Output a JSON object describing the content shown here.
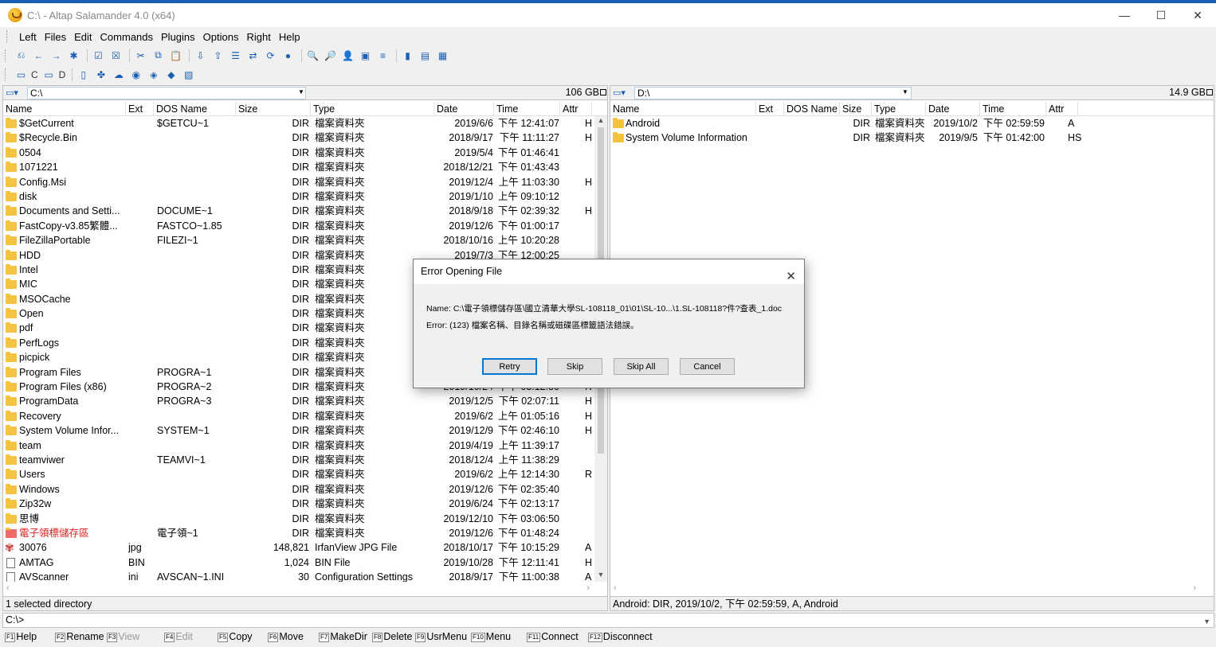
{
  "window": {
    "title": "C:\\ - Altap Salamander 4.0 (x64)",
    "minimize": "—",
    "maximize": "☐",
    "close": "✕"
  },
  "menu": [
    "Left",
    "Files",
    "Edit",
    "Commands",
    "Plugins",
    "Options",
    "Right",
    "Help"
  ],
  "drive_bar": {
    "c": "C",
    "d": "D"
  },
  "left_panel": {
    "path": "C:\\",
    "free_space": "106 GB",
    "columns": [
      "Name",
      "Ext",
      "DOS Name",
      "Size",
      "Type",
      "Date",
      "Time",
      "Attr"
    ],
    "rows": [
      {
        "icon": "folder",
        "name": "$GetCurrent",
        "ext": "",
        "dos": "$GETCU~1",
        "size": "DIR",
        "type": "檔案資料夾",
        "date": "2019/6/6",
        "time": "下午 12:41:07",
        "attr": "H"
      },
      {
        "icon": "folder",
        "name": "$Recycle.Bin",
        "ext": "",
        "dos": "",
        "size": "DIR",
        "type": "檔案資料夾",
        "date": "2018/9/17",
        "time": "下午 11:11:27",
        "attr": "HS"
      },
      {
        "icon": "folder",
        "name": "0504",
        "ext": "",
        "dos": "",
        "size": "DIR",
        "type": "檔案資料夾",
        "date": "2019/5/4",
        "time": "下午 01:46:41",
        "attr": ""
      },
      {
        "icon": "folder",
        "name": "1071221",
        "ext": "",
        "dos": "",
        "size": "DIR",
        "type": "檔案資料夾",
        "date": "2018/12/21",
        "time": "下午 01:43:43",
        "attr": ""
      },
      {
        "icon": "folder",
        "name": "Config.Msi",
        "ext": "",
        "dos": "",
        "size": "DIR",
        "type": "檔案資料夾",
        "date": "2019/12/4",
        "time": "上午 11:03:30",
        "attr": "HS"
      },
      {
        "icon": "folder",
        "name": "disk",
        "ext": "",
        "dos": "",
        "size": "DIR",
        "type": "檔案資料夾",
        "date": "2019/1/10",
        "time": "上午 09:10:12",
        "attr": ""
      },
      {
        "icon": "link",
        "name": "Documents and Setti...",
        "ext": "",
        "dos": "DOCUME~1",
        "size": "DIR",
        "type": "檔案資料夾",
        "date": "2018/9/18",
        "time": "下午 02:39:32",
        "attr": "HS"
      },
      {
        "icon": "folder",
        "name": "FastCopy-v3.85繁體...",
        "ext": "",
        "dos": "FASTCO~1.85",
        "size": "DIR",
        "type": "檔案資料夾",
        "date": "2019/12/6",
        "time": "下午 01:00:17",
        "attr": ""
      },
      {
        "icon": "folder",
        "name": "FileZillaPortable",
        "ext": "",
        "dos": "FILEZI~1",
        "size": "DIR",
        "type": "檔案資料夾",
        "date": "2018/10/16",
        "time": "上午 10:20:28",
        "attr": ""
      },
      {
        "icon": "folder",
        "name": "HDD",
        "ext": "",
        "dos": "",
        "size": "DIR",
        "type": "檔案資料夾",
        "date": "2019/7/3",
        "time": "下午 12:00:25",
        "attr": ""
      },
      {
        "icon": "folder",
        "name": "Intel",
        "ext": "",
        "dos": "",
        "size": "DIR",
        "type": "檔案資料夾",
        "date": "",
        "time": "",
        "attr": ""
      },
      {
        "icon": "folder",
        "name": "MIC",
        "ext": "",
        "dos": "",
        "size": "DIR",
        "type": "檔案資料夾",
        "date": "",
        "time": "",
        "attr": ""
      },
      {
        "icon": "folder",
        "name": "MSOCache",
        "ext": "",
        "dos": "",
        "size": "DIR",
        "type": "檔案資料夾",
        "date": "",
        "time": "",
        "attr": ""
      },
      {
        "icon": "folder",
        "name": "Open",
        "ext": "",
        "dos": "",
        "size": "DIR",
        "type": "檔案資料夾",
        "date": "",
        "time": "",
        "attr": ""
      },
      {
        "icon": "folder",
        "name": "pdf",
        "ext": "",
        "dos": "",
        "size": "DIR",
        "type": "檔案資料夾",
        "date": "",
        "time": "",
        "attr": ""
      },
      {
        "icon": "folder",
        "name": "PerfLogs",
        "ext": "",
        "dos": "",
        "size": "DIR",
        "type": "檔案資料夾",
        "date": "",
        "time": "",
        "attr": ""
      },
      {
        "icon": "folder",
        "name": "picpick",
        "ext": "",
        "dos": "",
        "size": "DIR",
        "type": "檔案資料夾",
        "date": "",
        "time": "",
        "attr": ""
      },
      {
        "icon": "folder",
        "name": "Program Files",
        "ext": "",
        "dos": "PROGRA~1",
        "size": "DIR",
        "type": "檔案資料夾",
        "date": "",
        "time": "",
        "attr": ""
      },
      {
        "icon": "folder",
        "name": "Program Files (x86)",
        "ext": "",
        "dos": "PROGRA~2",
        "size": "DIR",
        "type": "檔案資料夾",
        "date": "2019/10/24",
        "time": "下午 03:12:50",
        "attr": "R"
      },
      {
        "icon": "folder",
        "name": "ProgramData",
        "ext": "",
        "dos": "PROGRA~3",
        "size": "DIR",
        "type": "檔案資料夾",
        "date": "2019/12/5",
        "time": "下午 02:07:11",
        "attr": "H"
      },
      {
        "icon": "folder",
        "name": "Recovery",
        "ext": "",
        "dos": "",
        "size": "DIR",
        "type": "檔案資料夾",
        "date": "2019/6/2",
        "time": "上午 01:05:16",
        "attr": "HS"
      },
      {
        "icon": "folder",
        "name": "System Volume Infor...",
        "ext": "",
        "dos": "SYSTEM~1",
        "size": "DIR",
        "type": "檔案資料夾",
        "date": "2019/12/9",
        "time": "下午 02:46:10",
        "attr": "HS"
      },
      {
        "icon": "folder",
        "name": "team",
        "ext": "",
        "dos": "",
        "size": "DIR",
        "type": "檔案資料夾",
        "date": "2019/4/19",
        "time": "上午 11:39:17",
        "attr": ""
      },
      {
        "icon": "folder",
        "name": "teamviwer",
        "ext": "",
        "dos": "TEAMVI~1",
        "size": "DIR",
        "type": "檔案資料夾",
        "date": "2018/12/4",
        "time": "上午 11:38:29",
        "attr": ""
      },
      {
        "icon": "folder",
        "name": "Users",
        "ext": "",
        "dos": "",
        "size": "DIR",
        "type": "檔案資料夾",
        "date": "2019/6/2",
        "time": "上午 12:14:30",
        "attr": "R"
      },
      {
        "icon": "folder",
        "name": "Windows",
        "ext": "",
        "dos": "",
        "size": "DIR",
        "type": "檔案資料夾",
        "date": "2019/12/6",
        "time": "下午 02:35:40",
        "attr": ""
      },
      {
        "icon": "folder",
        "name": "Zip32w",
        "ext": "",
        "dos": "",
        "size": "DIR",
        "type": "檔案資料夾",
        "date": "2019/6/24",
        "time": "下午 02:13:17",
        "attr": ""
      },
      {
        "icon": "folder",
        "name": "思博",
        "ext": "",
        "dos": "",
        "size": "DIR",
        "type": "檔案資料夾",
        "date": "2019/12/10",
        "time": "下午 03:06:50",
        "attr": ""
      },
      {
        "icon": "folder-red",
        "name": "電子領標儲存區",
        "ext": "",
        "dos": "電子領~1",
        "size": "DIR",
        "type": "檔案資料夾",
        "date": "2019/12/6",
        "time": "下午 01:48:24",
        "attr": "",
        "highlight": true
      },
      {
        "icon": "image",
        "name": "30076",
        "ext": "jpg",
        "dos": "",
        "size": "148,821",
        "type": "IrfanView JPG File",
        "date": "2018/10/17",
        "time": "下午 10:15:29",
        "attr": "A"
      },
      {
        "icon": "file",
        "name": "AMTAG",
        "ext": "BIN",
        "dos": "",
        "size": "1,024",
        "type": "BIN File",
        "date": "2019/10/28",
        "time": "下午 12:11:41",
        "attr": "H"
      },
      {
        "icon": "file",
        "name": "AVScanner",
        "ext": "ini",
        "dos": "AVSCAN~1.INI",
        "size": "30",
        "type": "Configuration Settings",
        "date": "2018/9/17",
        "time": "下午 11:00:38",
        "attr": "A"
      }
    ],
    "status": "1 selected directory"
  },
  "right_panel": {
    "path": "D:\\",
    "free_space": "14.9 GB",
    "columns": [
      "Name",
      "Ext",
      "DOS Name",
      "Size",
      "Type",
      "Date",
      "Time",
      "Attr"
    ],
    "rows": [
      {
        "icon": "folder",
        "name": "Android",
        "size": "DIR",
        "type": "檔案資料夾",
        "date": "2019/10/2",
        "time": "下午 02:59:59",
        "attr": "A"
      },
      {
        "icon": "folder",
        "name": "System Volume Information",
        "size": "DIR",
        "type": "檔案資料夾",
        "date": "2019/9/5",
        "time": "下午 01:42:00",
        "attr": "HS"
      }
    ],
    "status": "Android: DIR, 2019/10/2, 下午 02:59:59, A, Android"
  },
  "command_line": "C:\\>",
  "fkeys": [
    {
      "key": "F1",
      "label": "Help",
      "enabled": true
    },
    {
      "key": "F2",
      "label": "Rename",
      "enabled": true
    },
    {
      "key": "F3",
      "label": "View",
      "enabled": false
    },
    {
      "key": "F4",
      "label": "Edit",
      "enabled": false
    },
    {
      "key": "F5",
      "label": "Copy",
      "enabled": true
    },
    {
      "key": "F6",
      "label": "Move",
      "enabled": true
    },
    {
      "key": "F7",
      "label": "MakeDir",
      "enabled": true
    },
    {
      "key": "F8",
      "label": "Delete",
      "enabled": true
    },
    {
      "key": "F9",
      "label": "UsrMenu",
      "enabled": true
    },
    {
      "key": "F10",
      "label": "Menu",
      "enabled": true
    },
    {
      "key": "F11",
      "label": "Connect",
      "enabled": true
    },
    {
      "key": "F12",
      "label": "Disconnect",
      "enabled": true
    }
  ],
  "dialog": {
    "title": "Error Opening File",
    "name_line": "Name: C:\\電子領標儲存區\\國立清華大學SL-108118_01\\01\\SL-10...\\1.SL-108118?件?查表_1.doc",
    "error_line": "Error: (123) 檔案名稱、目錄名稱或磁碟區標籤語法錯誤。",
    "buttons": [
      "Retry",
      "Skip",
      "Skip All",
      "Cancel"
    ]
  }
}
